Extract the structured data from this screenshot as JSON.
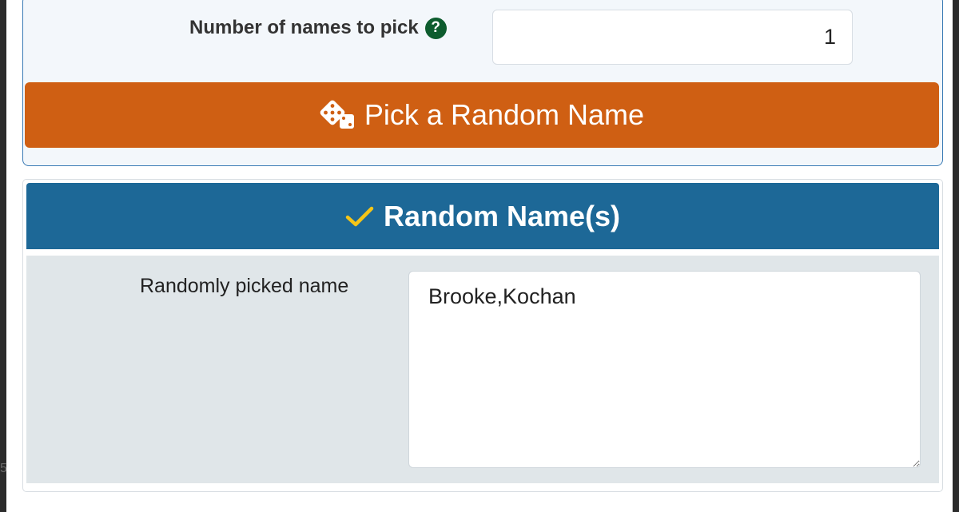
{
  "form": {
    "count_label": "Number of names to pick",
    "count_help_symbol": "?",
    "count_value": "1",
    "pick_button_label": "Pick a Random Name",
    "pick_button_icon": "dice-icon"
  },
  "result": {
    "header_icon": "check-icon",
    "title": "Random Name(s)",
    "picked_label": "Randomly picked name",
    "picked_value": "Brooke,Kochan"
  },
  "colors": {
    "button_orange": "#cf5f13",
    "header_blue": "#1d6897",
    "check_yellow": "#f5c518",
    "help_green": "#0d5c2e",
    "body_gray": "#e0e6e9"
  }
}
